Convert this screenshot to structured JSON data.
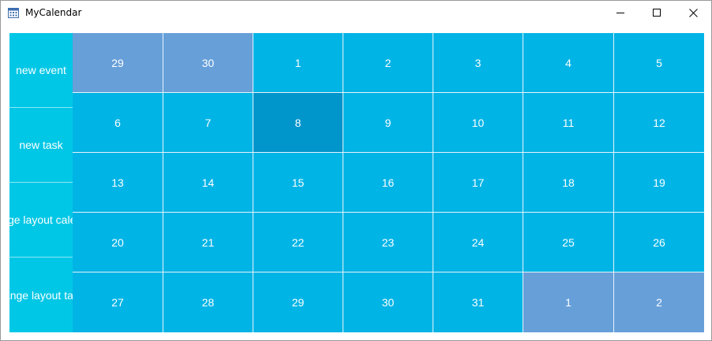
{
  "window": {
    "title": "MyCalendar",
    "app_icon": "calendar-icon",
    "controls": [
      "minimize-icon",
      "maximize-icon",
      "close-icon"
    ]
  },
  "sidebar": {
    "items": [
      {
        "label": "new event"
      },
      {
        "label": "new task"
      },
      {
        "label": "change layout calendar"
      },
      {
        "label": "change layout tasks"
      }
    ]
  },
  "calendar": {
    "weeks": [
      [
        "29",
        "30",
        "1",
        "2",
        "3",
        "4",
        "5"
      ],
      [
        "6",
        "7",
        "8",
        "9",
        "10",
        "11",
        "12"
      ],
      [
        "13",
        "14",
        "15",
        "16",
        "17",
        "18",
        "19"
      ],
      [
        "20",
        "21",
        "22",
        "23",
        "24",
        "25",
        "26"
      ],
      [
        "27",
        "28",
        "29",
        "30",
        "31",
        "1",
        "2"
      ]
    ],
    "other_month_cells": [
      [
        0,
        0
      ],
      [
        0,
        1
      ],
      [
        4,
        5
      ],
      [
        4,
        6
      ]
    ],
    "selected_cell": [
      1,
      2
    ]
  },
  "colors": {
    "sidebar": "#00c7e6",
    "day": "#00b4e6",
    "other_month": "#679fd9",
    "selected": "#0096cc",
    "text": "#ffffff"
  }
}
